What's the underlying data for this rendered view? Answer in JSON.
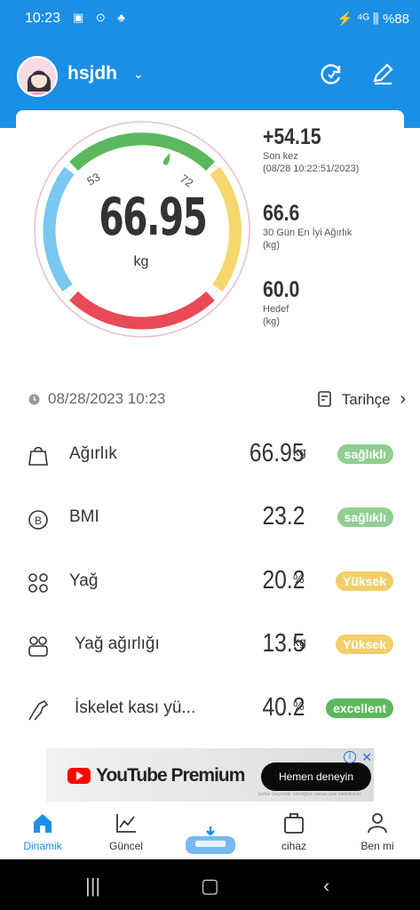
{
  "status_bar": {
    "time": "10:23",
    "icons": "▣ ⊙ ♣",
    "right": "⚡ ⁴ᴳ ⫼ %88"
  },
  "header": {
    "user_name": "hsjdh",
    "caret": "⌄",
    "refresh_icon": "refresh-icon",
    "edit_icon": "edit-icon"
  },
  "gauge": {
    "value": "66.95",
    "unit": "kg",
    "tick_left": "53",
    "tick_right": "72"
  },
  "stats": [
    {
      "value": "+54.15",
      "line1": "Son kez",
      "line2": "(08/28 10:22:51/2023)"
    },
    {
      "value": "66.6",
      "line1": "30 Gün En İyi Ağırlık",
      "line2": "(kg)"
    },
    {
      "value": "60.0",
      "line1": "Hedef",
      "line2": "(kg)"
    }
  ],
  "date_row": {
    "datetime": "08/28/2023 10:23",
    "history_label": "Tarihçe",
    "history_chevron": "›"
  },
  "metrics": [
    {
      "label": "Ağırlık",
      "value": "66.95",
      "unit": "kg",
      "badge": "sağlıklı",
      "badge_color": "#8fcf8f",
      "icon": "weight-icon"
    },
    {
      "label": "BMI",
      "value": "23.2",
      "unit": "",
      "badge": "sağlıklı",
      "badge_color": "#8fcf8f",
      "icon": "bmi-icon"
    },
    {
      "label": "Yağ",
      "value": "20.2",
      "unit": "%",
      "badge": "Yüksek",
      "badge_color": "#f2cf6b",
      "icon": "fat-icon"
    },
    {
      "label": "Yağ ağırlığı",
      "value": "13.5",
      "unit": "kg",
      "badge": "Yüksek",
      "badge_color": "#f2cf6b",
      "icon": "fat-weight-icon"
    },
    {
      "label": "İskelet kası yü...",
      "value": "40.2",
      "unit": "%",
      "badge": "excellent",
      "badge_color": "#5cb85c",
      "icon": "muscle-icon"
    }
  ],
  "ad": {
    "brand": "YouTube Premium",
    "cta": "Hemen deneyin",
    "note": "Şartlar Geçerlidir. İstediğiniz zaman iptal edebilirsiniz.",
    "info": "i",
    "close": "✕"
  },
  "tabs": [
    {
      "label": "Dinamik",
      "icon": "home-icon"
    },
    {
      "label": "Güncel",
      "icon": "chart-icon"
    },
    {
      "label": "cihaz",
      "icon": "device-icon"
    },
    {
      "label": "Ben mi",
      "icon": "profile-icon"
    }
  ],
  "colors": {
    "primary": "#1a8fe6",
    "gauge_green": "#5cb85c",
    "gauge_yellow": "#f5d76e",
    "gauge_red": "#e84b55",
    "gauge_blue": "#7ac7f0"
  }
}
